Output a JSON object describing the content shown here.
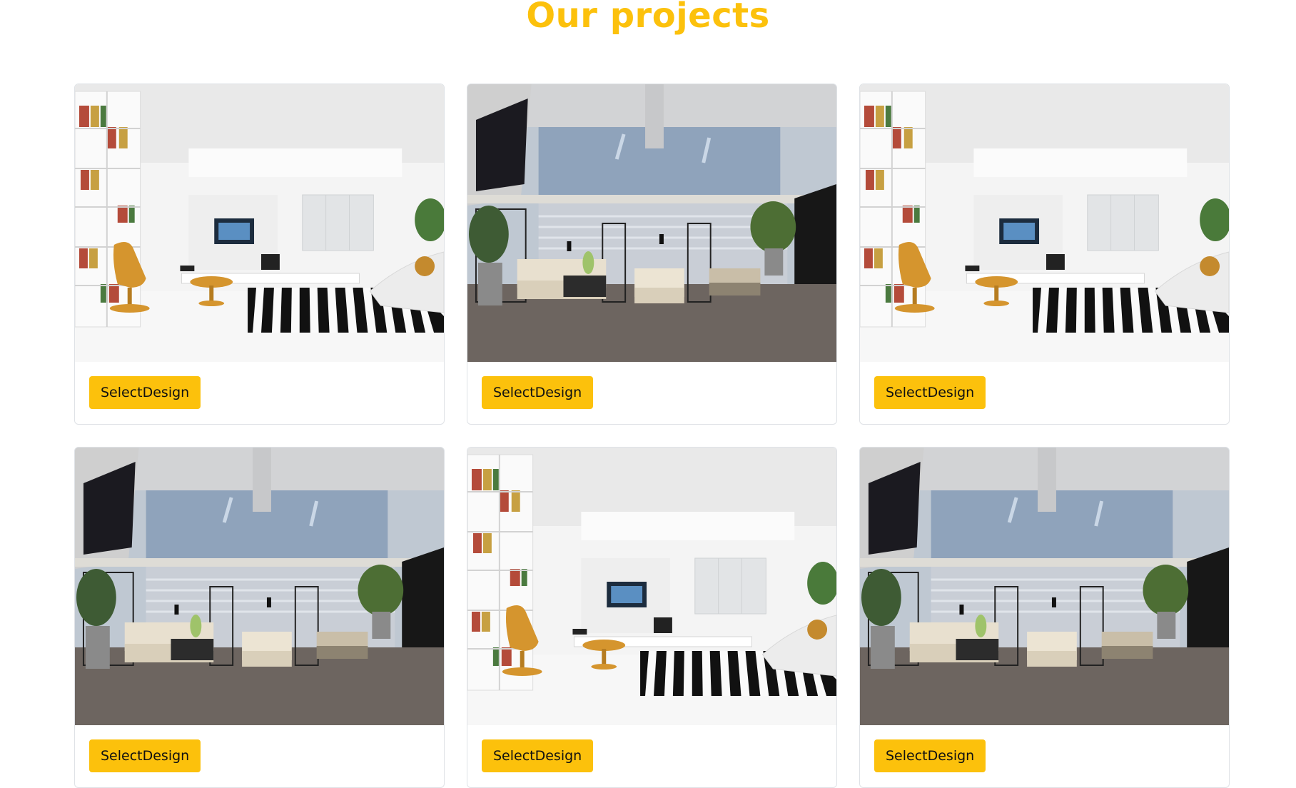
{
  "colors": {
    "accent": "#fcc10c",
    "button": "#fcc10c"
  },
  "heading": {
    "title": "Our projects"
  },
  "projects": [
    {
      "scene": "white-living-room",
      "button_label": "SelectDesign"
    },
    {
      "scene": "glass-office-lounge",
      "button_label": "SelectDesign"
    },
    {
      "scene": "white-living-room",
      "button_label": "SelectDesign"
    },
    {
      "scene": "glass-office-lounge",
      "button_label": "SelectDesign"
    },
    {
      "scene": "white-living-room",
      "button_label": "SelectDesign"
    },
    {
      "scene": "glass-office-lounge",
      "button_label": "SelectDesign"
    }
  ]
}
